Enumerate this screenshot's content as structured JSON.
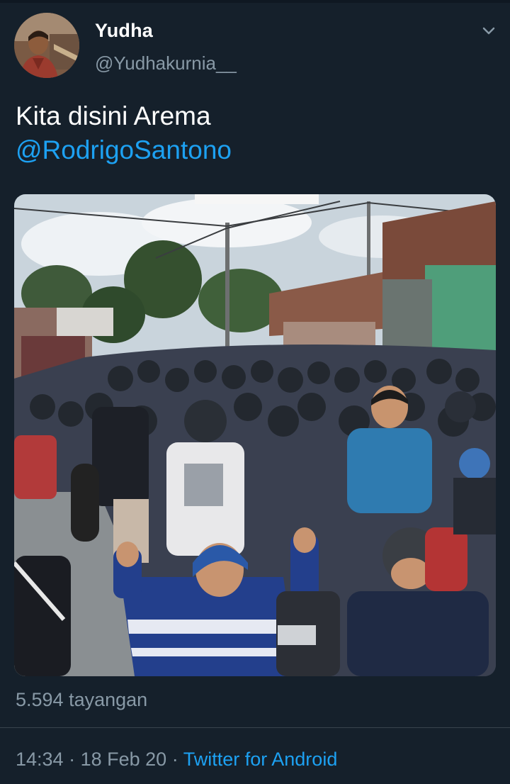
{
  "tweet": {
    "author": {
      "display_name": "Yudha",
      "handle": "@Yudhakurnia__"
    },
    "text": "Kita disini Arema",
    "mention": "@RodrigoSantono",
    "media": {
      "kind": "video"
    },
    "views": "5.594 tayangan",
    "time": "14:34",
    "separator": "·",
    "date": "18 Feb 20",
    "client": "Twitter for Android"
  },
  "icons": {
    "menu": "chevron-down-icon",
    "avatar": "avatar"
  },
  "colors": {
    "background": "#15202b",
    "primary_text": "#ffffff",
    "secondary_text": "#8899a6",
    "accent": "#1da1f2",
    "divider": "#38444d"
  }
}
